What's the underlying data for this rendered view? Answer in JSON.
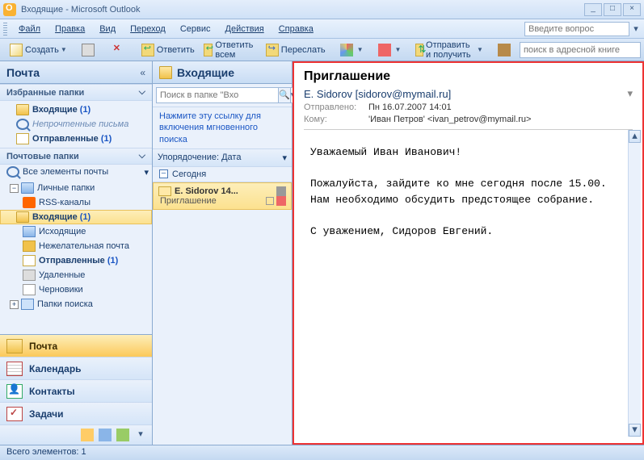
{
  "titlebar": {
    "text": "Входящие - Microsoft Outlook"
  },
  "menu": {
    "file": "Файл",
    "edit": "Правка",
    "view": "Вид",
    "go": "Переход",
    "tools": "Сервис",
    "actions": "Действия",
    "help": "Справка",
    "question_placeholder": "Введите вопрос"
  },
  "toolbar": {
    "create": "Создать",
    "reply": "Ответить",
    "reply_all": "Ответить всем",
    "forward": "Переслать",
    "send_receive": "Отправить и получить",
    "address_search_placeholder": "поиск в адресной книге"
  },
  "sidebar": {
    "title": "Почта",
    "fav_header": "Избранные папки",
    "fav": [
      {
        "label": "Входящие",
        "count": "(1)",
        "bold": true
      },
      {
        "label": "Непрочтенные письма",
        "italic": true
      },
      {
        "label": "Отправленные",
        "count": "(1)",
        "bold": true
      }
    ],
    "mail_header": "Почтовые папки",
    "all_items": "Все элементы почты",
    "tree_root": "Личные папки",
    "tree": [
      {
        "label": "RSS-каналы",
        "ic": "ic-rss"
      },
      {
        "label": "Входящие",
        "count": "(1)",
        "bold": true,
        "sel": true,
        "ic": "ic-fold-y"
      },
      {
        "label": "Исходящие",
        "ic": "ic-out"
      },
      {
        "label": "Нежелательная почта",
        "ic": "ic-junk"
      },
      {
        "label": "Отправленные",
        "count": "(1)",
        "bold": true,
        "ic": "ic-sent"
      },
      {
        "label": "Удаленные",
        "ic": "ic-trash"
      },
      {
        "label": "Черновики",
        "ic": "ic-draft"
      }
    ],
    "search_folders": "Папки поиска",
    "nav": [
      "Почта",
      "Календарь",
      "Контакты",
      "Задачи"
    ]
  },
  "inbox": {
    "title": "Входящие",
    "search_placeholder": "Поиск в папке \"Вхо",
    "hint": "Нажмите эту ссылку для включения мгновенного поиска",
    "sort_label": "Упорядочение: Дата",
    "group": "Сегодня",
    "msg": {
      "from": "E. Sidorov 14...",
      "subject": "Приглашение"
    }
  },
  "reading": {
    "subject": "Приглашение",
    "sender": "E. Sidorov [sidorov@mymail.ru]",
    "sent_lbl": "Отправлено:",
    "sent_val": "Пн 16.07.2007 14:01",
    "to_lbl": "Кому:",
    "to_val": "'Иван Петров' <ivan_petrov@mymail.ru>",
    "body_line1": "Уважаемый Иван Иванович!",
    "body_line2": "Пожалуйста, зайдите ко мне сегодня после 15.00.",
    "body_line3": "Нам необходимо обсудить предстоящее собрание.",
    "body_line4": "С уважением, Сидоров Евгений."
  },
  "status": {
    "text": "Всего элементов: 1"
  }
}
